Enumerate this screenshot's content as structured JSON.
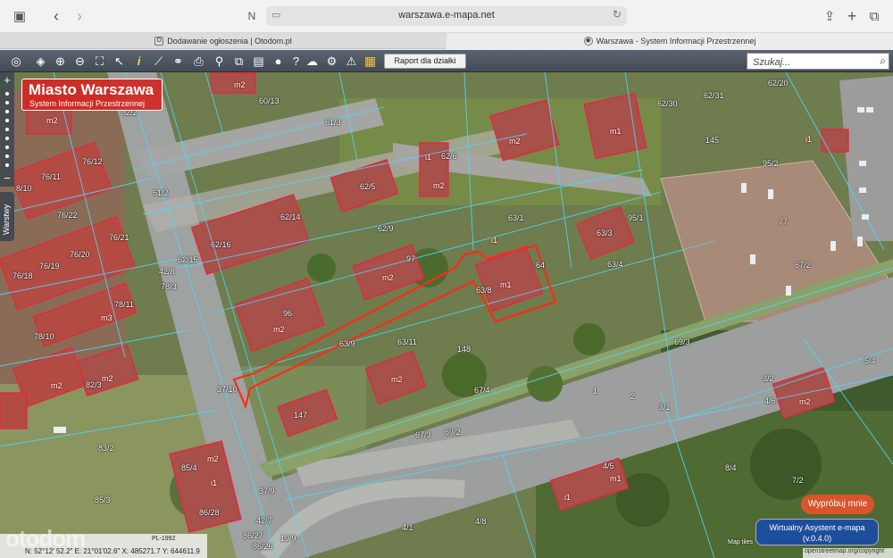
{
  "browser": {
    "url": "warszawa.e-mapa.net",
    "tabs": [
      {
        "label": "Dodawanie ogłoszenia | Otodom.pl",
        "icon": "otodom-favicon"
      },
      {
        "label": "Warszawa - System Informacji Przestrzennej",
        "icon": "emapa-favicon"
      }
    ]
  },
  "toolbar": {
    "report_label": "Raport dla działki",
    "search_placeholder": "Szukaj...",
    "icons": [
      "globe-icon",
      "layers-icon",
      "zoom-in-icon",
      "zoom-out-icon",
      "extent-icon",
      "info-icon",
      "select-arrow-icon",
      "measure-icon",
      "link-icon",
      "print-icon",
      "stamp-icon",
      "compare-icon",
      "split-icon",
      "speech-icon",
      "help-icon",
      "cloud-icon",
      "settings-icon",
      "warning-icon",
      "mosaic-icon"
    ]
  },
  "badge": {
    "title": "Miasto Warszawa",
    "subtitle": "System Informacji Przestrzennej"
  },
  "sidebar": {
    "layers_label": "Warstwy",
    "zoom_in": "+",
    "zoom_out": "−"
  },
  "map_labels": {
    "parcels": [
      "60/13",
      "61/3",
      "62/31",
      "62/20",
      "62/30",
      "145",
      "62/6",
      "62/5",
      "61/2",
      "62/14",
      "62/9",
      "63/1",
      "95/1",
      "95/2",
      "77",
      "76/22",
      "62/16",
      "62/15",
      "63/3",
      "63/4",
      "67/2",
      "42/8",
      "78/3",
      "97",
      "63/8",
      "64",
      "76/20",
      "76/19",
      "76/18",
      "78/11",
      "78/10",
      "96",
      "63/9",
      "63/11",
      "148",
      "69/3",
      "37/10",
      "67/4",
      "1",
      "2",
      "5/4",
      "3/2",
      "3/1",
      "82/3",
      "147",
      "67/3",
      "69/2",
      "83/2",
      "4/6",
      "85/4",
      "8/4",
      "4/5",
      "7/2",
      "85/3",
      "86/28",
      "37/9",
      "42/7",
      "86/27",
      "86/26",
      "19/9",
      "4/8",
      "4/1",
      "76/12",
      "76/11",
      "8/10",
      "76/21",
      "82/2"
    ],
    "buildings": [
      "m2",
      "m1",
      "i1",
      "m2",
      "m2",
      "m1",
      "i1",
      "m2",
      "i1",
      "m2",
      "m3",
      "m2",
      "m2",
      "m2",
      "m2",
      "i1",
      "m2",
      "m1",
      "i1",
      "m2"
    ]
  },
  "widgets": {
    "try_label": "Wypróbuj mnie",
    "assistant_line1": "Wirtualny Asystent e-mapa",
    "assistant_line2": "(v.0.4.0)",
    "map_tiles": "Map tiles",
    "osm_credit": "openstreetmap.org/copyright"
  },
  "status": {
    "crs": "PL-1992",
    "coords_text": "N: 52°12′ 52.2″ E: 21°01′02.6″  X: 485271.7  Y: 644611.9"
  },
  "watermark": "otodom",
  "colors": {
    "toolbar": "#4d5661",
    "badge": "#d2281f",
    "parcel_line": "#4fd8ff",
    "building_line": "#e8243c",
    "highlight": "#ff2a1a",
    "assistant": "#1d4e9c",
    "try_button": "#d9542c"
  }
}
